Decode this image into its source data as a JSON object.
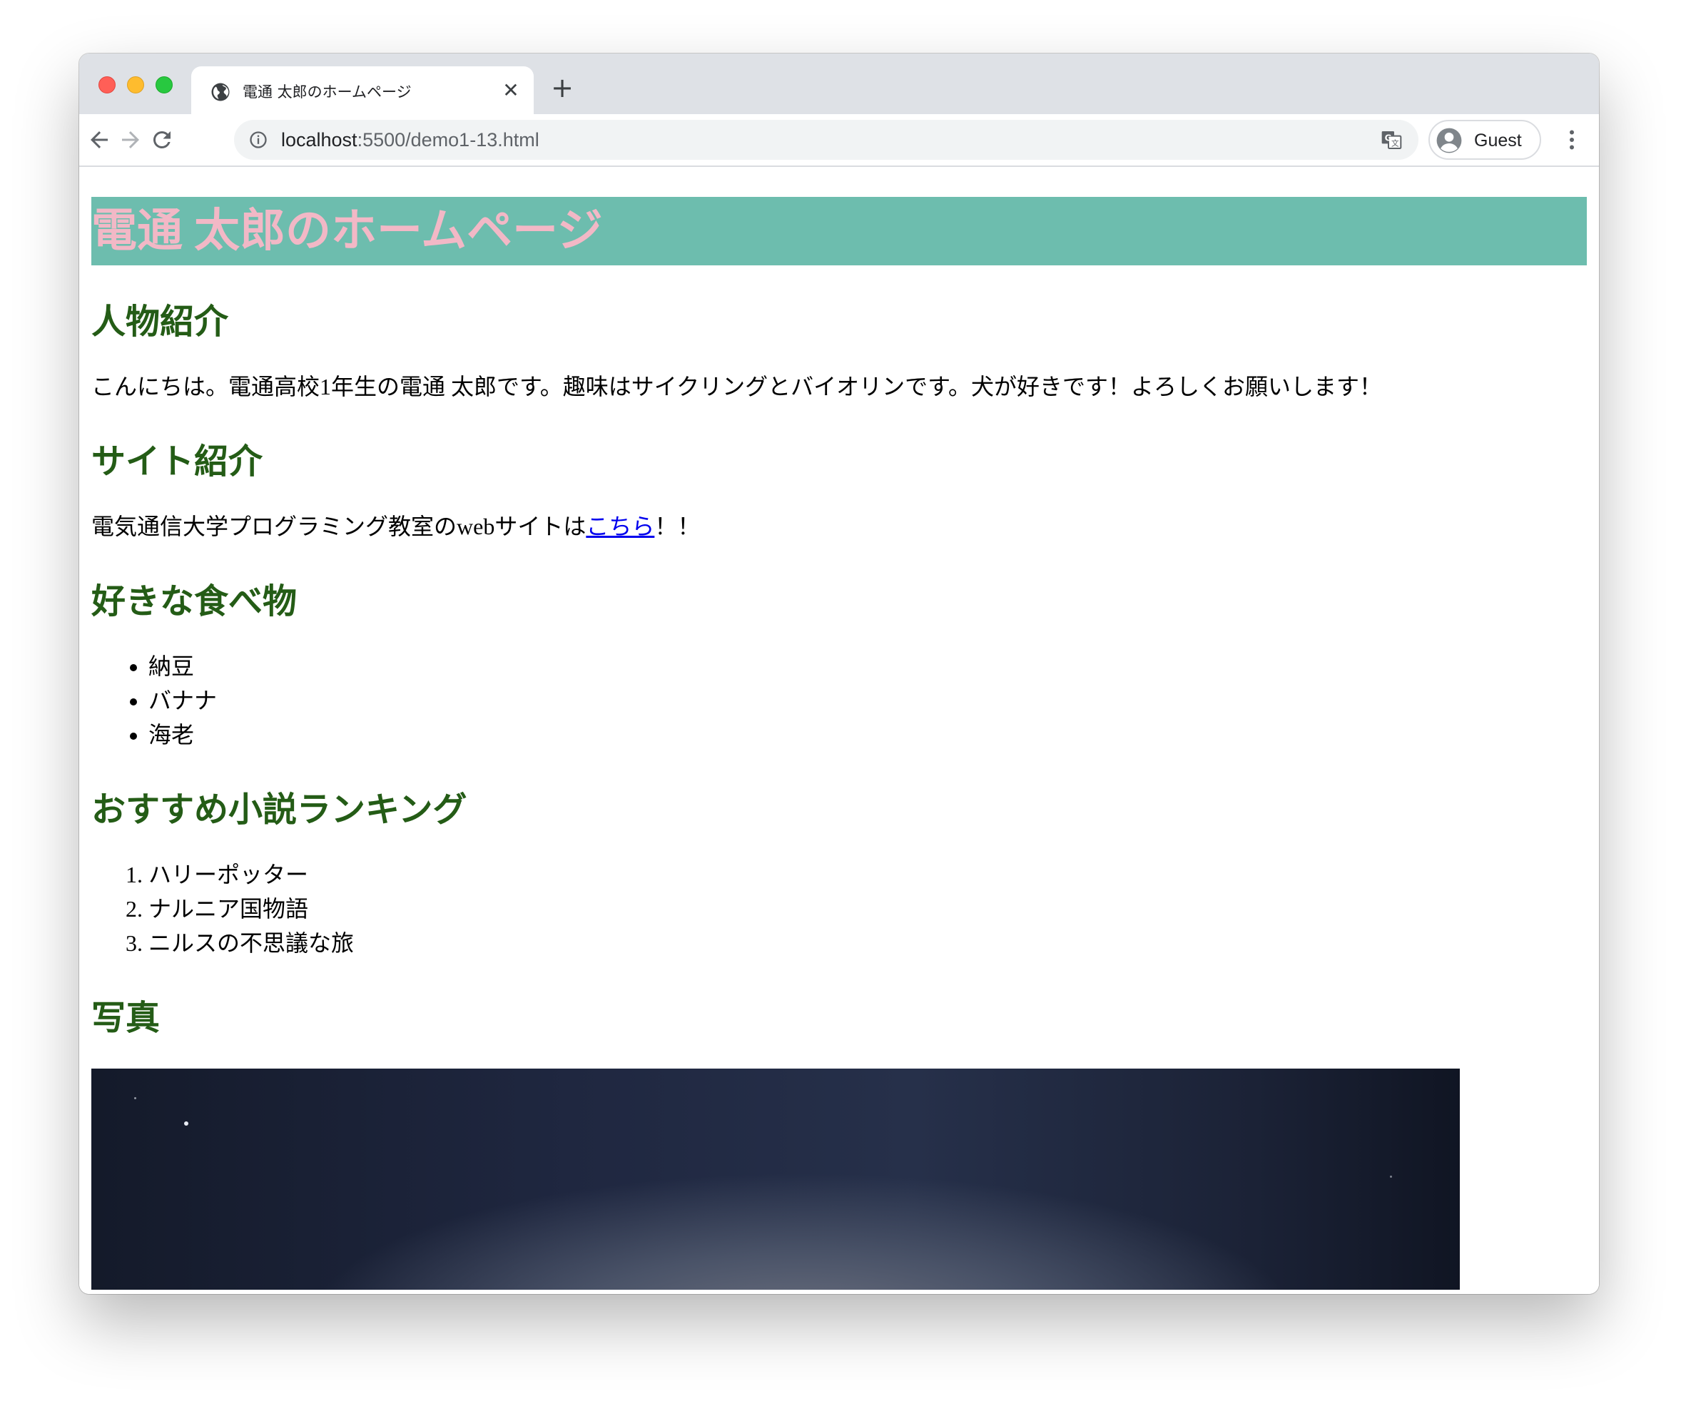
{
  "browser": {
    "tab_title": "電通 太郎のホームページ",
    "new_tab_label": "+",
    "tab_close_label": "✕",
    "url_host": "localhost",
    "url_path": ":5500/demo1-13.html",
    "profile_label": "Guest",
    "icons": [
      "globe-icon",
      "back-icon",
      "forward-icon",
      "reload-icon",
      "info-icon",
      "translate-icon",
      "avatar-icon",
      "menu-dots-icon"
    ]
  },
  "page": {
    "title": "電通 太郎のホームページ",
    "profile": {
      "heading": "人物紹介",
      "text": "こんにちは。電通高校1年生の電通 太郎です。趣味はサイクリングとバイオリンです。犬が好きです！よろしくお願いします！"
    },
    "site": {
      "heading": "サイト紹介",
      "text_before": "電気通信大学プログラミング教室のwebサイトは",
      "link_text": "こちら",
      "text_after": "！！"
    },
    "foods": {
      "heading": "好きな食べ物",
      "items": [
        "納豆",
        "バナナ",
        "海老"
      ]
    },
    "novels": {
      "heading": "おすすめ小説ランキング",
      "items": [
        "ハリーポッター",
        "ナルニア国物語",
        "ニルスの不思議な旅"
      ]
    },
    "photo": {
      "heading": "写真"
    }
  },
  "colors": {
    "title_bg": "#6dbdae",
    "title_text": "#f2b8c6",
    "heading": "#245c16",
    "link": "#0000ee"
  }
}
